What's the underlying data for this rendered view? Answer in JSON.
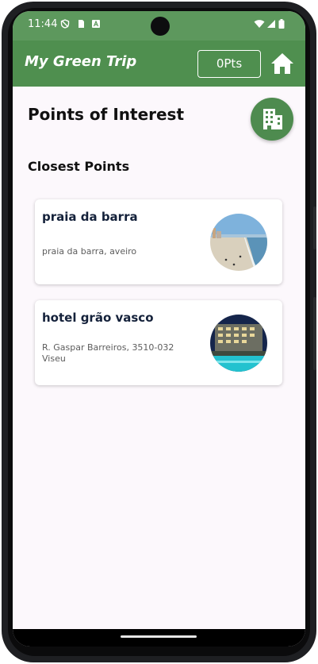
{
  "status_bar": {
    "time": "11:44",
    "icons": [
      "shield-icon",
      "sim-card-icon",
      "app-a-icon",
      "wifi-icon",
      "signal-icon",
      "battery-icon"
    ]
  },
  "app_bar": {
    "title": "My Green Trip",
    "points_label": "0Pts",
    "home_icon": "home-icon"
  },
  "page": {
    "title": "Points of Interest",
    "fab_icon": "building-icon",
    "section_title": "Closest Points"
  },
  "points": [
    {
      "name": "praia da barra",
      "address": "praia da barra, aveiro",
      "image": "beach-photo"
    },
    {
      "name": "hotel grão vasco",
      "address": "R. Gaspar Barreiros, 3510-032 Viseu",
      "image": "hotel-photo"
    }
  ],
  "colors": {
    "status_bar": "#5d985d",
    "app_bar": "#4f8f4f",
    "fab": "#4e8b4f",
    "background": "#fcf8fc",
    "card_title": "#14213a"
  }
}
